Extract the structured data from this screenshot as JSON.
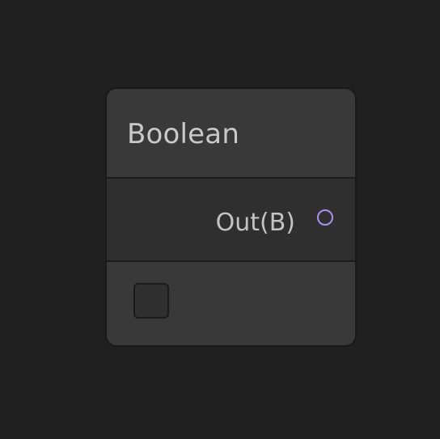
{
  "node": {
    "title": "Boolean",
    "output": {
      "label": "Out(B)",
      "port_color": "#a692e8"
    },
    "value": {
      "checked": false
    }
  },
  "colors": {
    "canvas": "#202020",
    "node_body": "#393939",
    "output_row": "#2f2f2f",
    "text": "#c9c9c9"
  }
}
